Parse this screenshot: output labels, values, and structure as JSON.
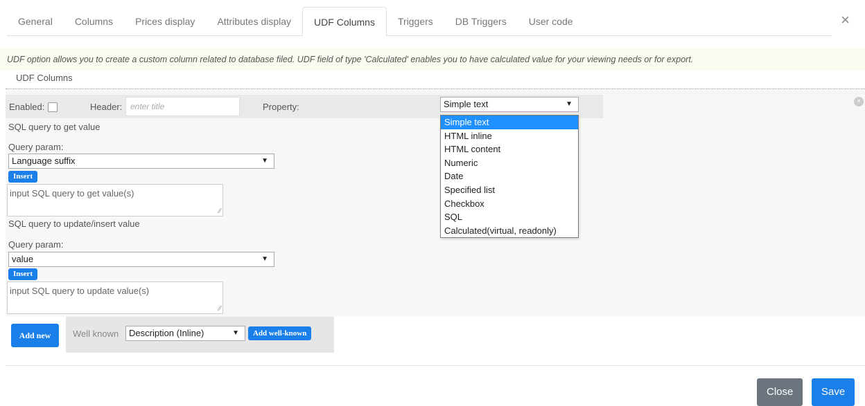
{
  "tabs": [
    "General",
    "Columns",
    "Prices display",
    "Attributes display",
    "UDF Columns",
    "Triggers",
    "DB Triggers",
    "User code"
  ],
  "close_icon": "×",
  "info_text": "UDF option allows you to create a custom column related to database filed. UDF field of type 'Calculated' enables you to have calculated value for your viewing needs or for export.",
  "section_title": "UDF Columns",
  "row": {
    "enabled_label": "Enabled:",
    "header_label": "Header:",
    "header_placeholder": "enter title",
    "property_label": "Property:",
    "property_value": "Simple text",
    "property_options": [
      "Simple text",
      "HTML inline",
      "HTML content",
      "Numeric",
      "Date",
      "Specified list",
      "Checkbox",
      "SQL",
      "Calculated(virtual, readonly)"
    ],
    "remove_icon": "×"
  },
  "get_value": {
    "title": "SQL query to get value",
    "param_label": "Query param:",
    "param_value": "Language suffix",
    "insert_label": "Insert",
    "textarea_placeholder": "input SQL query to get value(s)"
  },
  "update_value": {
    "title": "SQL query to update/insert value",
    "param_label": "Query param:",
    "param_value": "value",
    "insert_label": "Insert",
    "textarea_placeholder": "input SQL query to update value(s)"
  },
  "add_new_label": "Add new",
  "well_known": {
    "label": "Well known",
    "value": "Description (Inline)",
    "add_label": "Add well-known"
  },
  "footer": {
    "close_label": "Close",
    "save_label": "Save"
  },
  "colors": {
    "accent": "#1a7fe8",
    "highlight": "#1e90ff",
    "secondary": "#6c757d"
  }
}
